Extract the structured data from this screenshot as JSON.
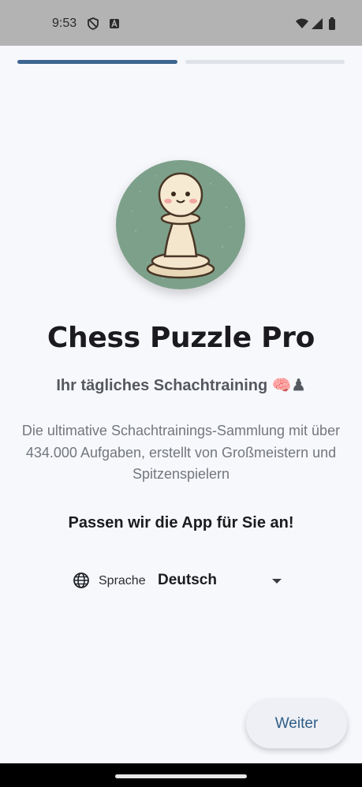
{
  "status_bar": {
    "time": "9:53",
    "icons": [
      "shield-icon",
      "a-badge-icon",
      "wifi-icon",
      "signal-icon",
      "battery-icon"
    ]
  },
  "progress": {
    "current_step": 1,
    "total_steps": 2
  },
  "hero": {
    "icon": "pawn-mascot-icon"
  },
  "app": {
    "title": "Chess Puzzle Pro",
    "subtitle": "Ihr tägliches Schachtraining 🧠♟",
    "description": "Die ultimative Schachtrainings-Sammlung mit über 434.000 Aufgaben, erstellt von Großmeistern und Spitzenspielern"
  },
  "setup": {
    "heading": "Passen wir die App für Sie an!"
  },
  "language": {
    "label": "Sprache",
    "value": "Deutsch"
  },
  "actions": {
    "next_label": "Weiter"
  },
  "colors": {
    "accent": "#3d6590",
    "button_text": "#2f5d86",
    "avatar_bg": "#7da08a",
    "background": "#f7f8fc"
  }
}
